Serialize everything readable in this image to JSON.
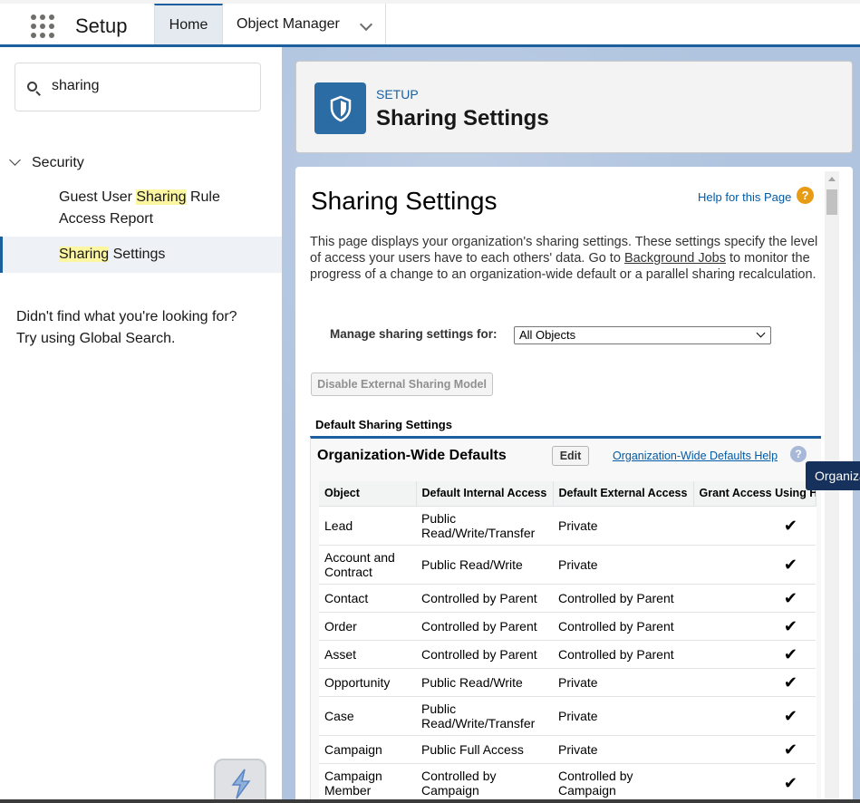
{
  "topnav": {
    "app_name": "Setup",
    "tabs": [
      {
        "label": "Home"
      },
      {
        "label": "Object Manager"
      }
    ]
  },
  "sidebar": {
    "search_value": "sharing",
    "section_label": "Security",
    "items": [
      {
        "pre": "Guest User ",
        "hl": "Sharing",
        "post": " Rule Access Report"
      },
      {
        "pre": "",
        "hl": "Sharing",
        "post": " Settings"
      }
    ],
    "not_found_line1": "Didn't find what you're looking for?",
    "not_found_line2": "Try using Global Search."
  },
  "header": {
    "eyebrow": "SETUP",
    "title": "Sharing Settings"
  },
  "content": {
    "title": "Sharing Settings",
    "help_link": "Help for this Page",
    "help_badge": "?",
    "desc_part1": "This page displays your organization's sharing settings. These settings specify the level of access your users have to each others' data. Go to ",
    "desc_link": "Background Jobs",
    "desc_part2": " to monitor the progress of a change to an organization-wide default or a parallel sharing recalculation.",
    "manage_label": "Manage sharing settings for:",
    "manage_value": "All Objects",
    "disable_button": "Disable External Sharing Model",
    "default_title": "Default Sharing Settings"
  },
  "owd": {
    "title": "Organization-Wide Defaults",
    "edit_button": "Edit",
    "help_link": "Organization-Wide Defaults Help",
    "help_badge": "?",
    "columns": [
      "Object",
      "Default Internal Access",
      "Default External Access",
      "Grant Access Using Hierarchies"
    ],
    "rows": [
      {
        "object": "Lead",
        "internal": "Public Read/Write/Transfer",
        "external": "Private",
        "grant": "✔"
      },
      {
        "object": "Account and Contract",
        "internal": "Public Read/Write",
        "external": "Private",
        "grant": "✔"
      },
      {
        "object": "Contact",
        "internal": "Controlled by Parent",
        "external": "Controlled by Parent",
        "grant": "✔"
      },
      {
        "object": "Order",
        "internal": "Controlled by Parent",
        "external": "Controlled by Parent",
        "grant": "✔"
      },
      {
        "object": "Asset",
        "internal": "Controlled by Parent",
        "external": "Controlled by Parent",
        "grant": "✔"
      },
      {
        "object": "Opportunity",
        "internal": "Public Read/Write",
        "external": "Private",
        "grant": "✔"
      },
      {
        "object": "Case",
        "internal": "Public Read/Write/Transfer",
        "external": "Private",
        "grant": "✔"
      },
      {
        "object": "Campaign",
        "internal": "Public Full Access",
        "external": "Private",
        "grant": "✔"
      },
      {
        "object": "Campaign Member",
        "internal": "Controlled by Campaign",
        "external": "Controlled by Campaign",
        "grant": "✔"
      }
    ]
  },
  "tooltip": "Organization-Wide Defaults Help",
  "colors": {
    "brand_blue": "#1b5f9e",
    "link_blue": "#015ba7",
    "highlight": "#fcf6a1",
    "help_orange": "#e89b14"
  }
}
